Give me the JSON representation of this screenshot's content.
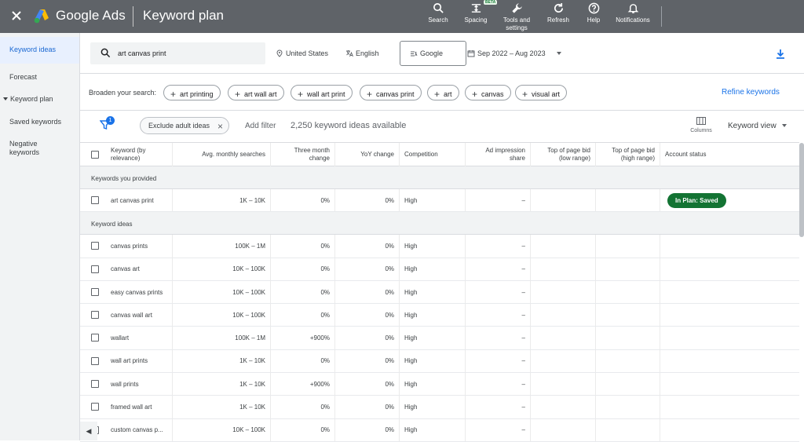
{
  "topbar": {
    "close_icon": "close-icon",
    "brand": "Google Ads",
    "product": "Keyword plan",
    "tools": [
      {
        "label": "Search",
        "icon": "search-icon"
      },
      {
        "label": "Spacing",
        "icon": "spacing-icon",
        "beta": "BETA"
      },
      {
        "label": "Tools and settings",
        "icon": "wrench-icon"
      },
      {
        "label": "Refresh",
        "icon": "refresh-icon"
      },
      {
        "label": "Help",
        "icon": "help-icon"
      },
      {
        "label": "Notifications",
        "icon": "bell-icon"
      }
    ],
    "tools_line1": "Tools and",
    "tools_line2": "settings"
  },
  "sidebar": {
    "items": [
      {
        "label": "Keyword ideas",
        "active": true
      },
      {
        "label": "Forecast"
      },
      {
        "label": "Keyword plan"
      },
      {
        "label": "Saved keywords"
      },
      {
        "label": "Negative keywords"
      }
    ],
    "negative_line1": "Negative",
    "negative_line2": "keywords"
  },
  "search": {
    "query": "art canvas print",
    "location": "United States",
    "language": "English",
    "network": "Google",
    "date_range": "Sep 2022 – Aug 2023"
  },
  "broaden": {
    "label": "Broaden your search:",
    "chips": [
      "art printing",
      "art wall art",
      "wall art print",
      "canvas print",
      "art",
      "canvas",
      "visual art"
    ],
    "refine": "Refine keywords"
  },
  "toolbar": {
    "filter_badge": "1",
    "exclude_chip": "Exclude adult ideas",
    "add_filter": "Add filter",
    "available": "2,250 keyword ideas available",
    "columns": "Columns",
    "keyword_view": "Keyword view"
  },
  "table": {
    "headers": {
      "keyword_line1": "Keyword (by",
      "keyword_line2": "relevance)",
      "avg": "Avg. monthly searches",
      "three_line1": "Three month",
      "three_line2": "change",
      "yoy": "YoY change",
      "competition": "Competition",
      "adimp_line1": "Ad impression",
      "adimp_line2": "share",
      "low_line1": "Top of page bid",
      "low_line2": "(low range)",
      "high_line1": "Top of page bid",
      "high_line2": "(high range)",
      "status": "Account status"
    },
    "group_provided": "Keywords you provided",
    "provided_rows": [
      {
        "keyword": "art canvas print",
        "avg": "1K – 10K",
        "three": "0%",
        "yoy": "0%",
        "competition": "High",
        "adimp": "–",
        "status": "In Plan: Saved"
      }
    ],
    "group_ideas": "Keyword ideas",
    "idea_rows": [
      {
        "keyword": "canvas prints",
        "avg": "100K – 1M",
        "three": "0%",
        "yoy": "0%",
        "competition": "High",
        "adimp": "–"
      },
      {
        "keyword": "canvas art",
        "avg": "10K – 100K",
        "three": "0%",
        "yoy": "0%",
        "competition": "High",
        "adimp": "–"
      },
      {
        "keyword": "easy canvas prints",
        "avg": "10K – 100K",
        "three": "0%",
        "yoy": "0%",
        "competition": "High",
        "adimp": "–"
      },
      {
        "keyword": "canvas wall art",
        "avg": "10K – 100K",
        "three": "0%",
        "yoy": "0%",
        "competition": "High",
        "adimp": "–"
      },
      {
        "keyword": "wallart",
        "avg": "100K – 1M",
        "three": "+900%",
        "yoy": "0%",
        "competition": "High",
        "adimp": "–"
      },
      {
        "keyword": "wall art prints",
        "avg": "1K – 10K",
        "three": "0%",
        "yoy": "0%",
        "competition": "High",
        "adimp": "–"
      },
      {
        "keyword": "wall prints",
        "avg": "1K – 10K",
        "three": "+900%",
        "yoy": "0%",
        "competition": "High",
        "adimp": "–"
      },
      {
        "keyword": "framed wall art",
        "avg": "1K – 10K",
        "three": "0%",
        "yoy": "0%",
        "competition": "High",
        "adimp": "–"
      },
      {
        "keyword": "custom canvas p...",
        "avg": "10K – 100K",
        "three": "0%",
        "yoy": "0%",
        "competition": "High",
        "adimp": "–"
      }
    ]
  },
  "colors": {
    "topbar": "#5f6368",
    "accent": "#1a73e8",
    "plan_badge": "#137333"
  }
}
